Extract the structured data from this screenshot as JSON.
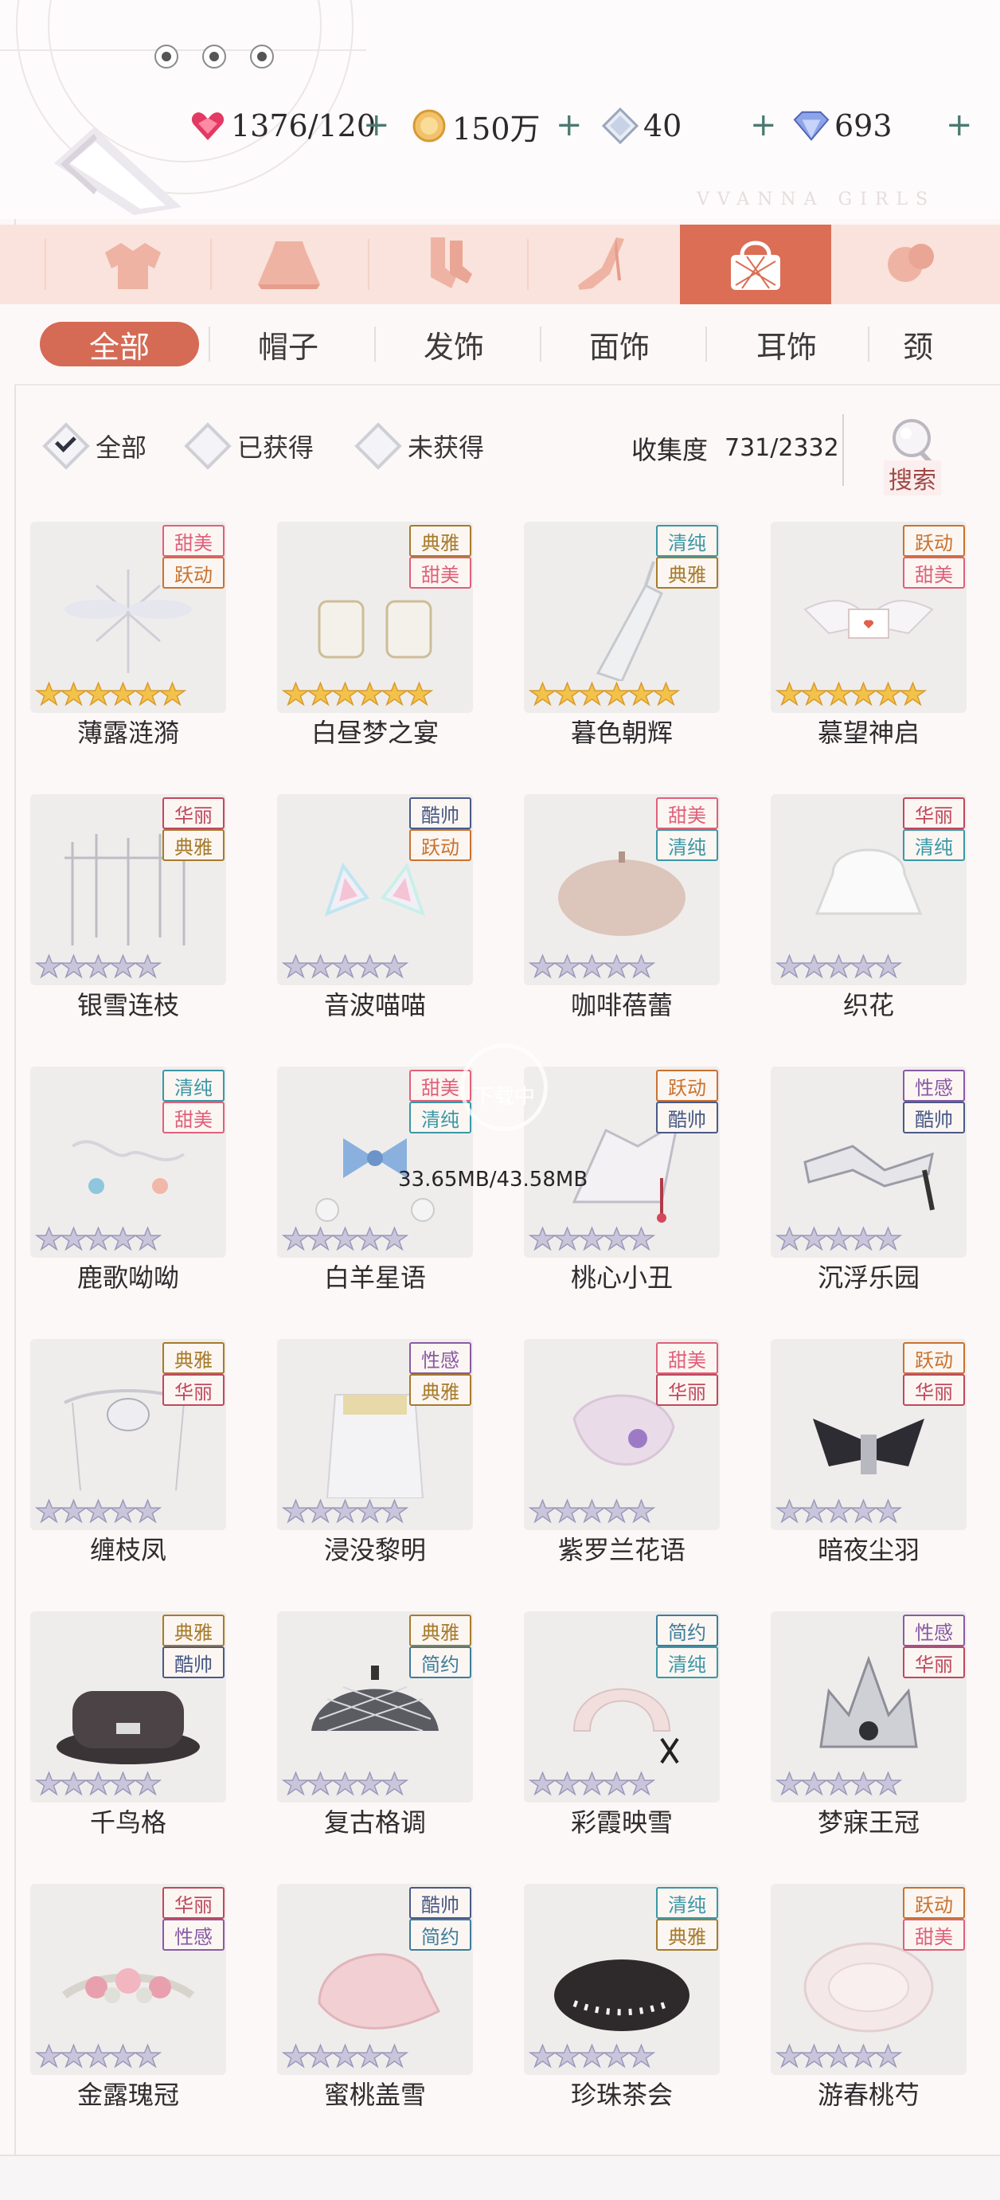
{
  "header": {
    "brand": "VVANNA GIRLS",
    "resources": [
      {
        "icon": "heart-gem-icon",
        "value": "1376/120"
      },
      {
        "icon": "gold-coin-icon",
        "value": "150万"
      },
      {
        "icon": "crystal-icon",
        "value": "40"
      },
      {
        "icon": "diamond-icon",
        "value": "693"
      }
    ],
    "plus_label": "+"
  },
  "categories": [
    {
      "icon": "hair-icon"
    },
    {
      "icon": "top-icon"
    },
    {
      "icon": "skirt-icon"
    },
    {
      "icon": "socks-icon"
    },
    {
      "icon": "shoes-icon"
    },
    {
      "icon": "handbag-icon",
      "active": true
    },
    {
      "icon": "makeup-icon"
    }
  ],
  "subcategories": [
    "全部",
    "帽子",
    "发饰",
    "面饰",
    "耳饰",
    "颈"
  ],
  "filters": [
    "全部",
    "已获得",
    "未获得"
  ],
  "collection": {
    "label": "收集度",
    "value": "731/2332"
  },
  "search_label": "搜索",
  "download": {
    "status": "下载中",
    "size": "33.65MB/43.58MB"
  },
  "tag_colors": {
    "甜美": "#e0607a",
    "跃动": "#c9722f",
    "典雅": "#a77a2a",
    "清纯": "#3b97a6",
    "华丽": "#c0485e",
    "酷帅": "#4a5a86",
    "性感": "#8a5aa6",
    "简约": "#3d7d9b"
  },
  "items": [
    {
      "name": "薄露涟漪",
      "tags": [
        "甜美",
        "跃动"
      ],
      "stars": 6,
      "gold": true
    },
    {
      "name": "白昼梦之宴",
      "tags": [
        "典雅",
        "甜美"
      ],
      "stars": 6,
      "gold": true
    },
    {
      "name": "暮色朝辉",
      "tags": [
        "清纯",
        "典雅"
      ],
      "stars": 6,
      "gold": true
    },
    {
      "name": "慕望神启",
      "tags": [
        "跃动",
        "甜美"
      ],
      "stars": 6,
      "gold": true
    },
    {
      "name": "银雪连枝",
      "tags": [
        "华丽",
        "典雅"
      ],
      "stars": 5,
      "gold": false
    },
    {
      "name": "音波喵喵",
      "tags": [
        "酷帅",
        "跃动"
      ],
      "stars": 5,
      "gold": false
    },
    {
      "name": "咖啡蓓蕾",
      "tags": [
        "甜美",
        "清纯"
      ],
      "stars": 5,
      "gold": false
    },
    {
      "name": "织花",
      "tags": [
        "华丽",
        "清纯"
      ],
      "stars": 5,
      "gold": false
    },
    {
      "name": "鹿歌呦呦",
      "tags": [
        "清纯",
        "甜美"
      ],
      "stars": 5,
      "gold": false
    },
    {
      "name": "白羊星语",
      "tags": [
        "甜美",
        "清纯"
      ],
      "stars": 5,
      "gold": false
    },
    {
      "name": "桃心小丑",
      "tags": [
        "跃动",
        "酷帅"
      ],
      "stars": 5,
      "gold": false
    },
    {
      "name": "沉浮乐园",
      "tags": [
        "性感",
        "酷帅"
      ],
      "stars": 5,
      "gold": false
    },
    {
      "name": "缠枝凤",
      "tags": [
        "典雅",
        "华丽"
      ],
      "stars": 5,
      "gold": false
    },
    {
      "name": "浸没黎明",
      "tags": [
        "性感",
        "典雅"
      ],
      "stars": 5,
      "gold": false
    },
    {
      "name": "紫罗兰花语",
      "tags": [
        "甜美",
        "华丽"
      ],
      "stars": 5,
      "gold": false
    },
    {
      "name": "暗夜尘羽",
      "tags": [
        "跃动",
        "华丽"
      ],
      "stars": 5,
      "gold": false
    },
    {
      "name": "千鸟格",
      "tags": [
        "典雅",
        "酷帅"
      ],
      "stars": 5,
      "gold": false
    },
    {
      "name": "复古格调",
      "tags": [
        "典雅",
        "简约"
      ],
      "stars": 5,
      "gold": false
    },
    {
      "name": "彩霞映雪",
      "tags": [
        "简约",
        "清纯"
      ],
      "stars": 5,
      "gold": false
    },
    {
      "name": "梦寐王冠",
      "tags": [
        "性感",
        "华丽"
      ],
      "stars": 5,
      "gold": false
    },
    {
      "name": "金露瑰冠",
      "tags": [
        "华丽",
        "性感"
      ],
      "stars": 5,
      "gold": false
    },
    {
      "name": "蜜桃盖雪",
      "tags": [
        "酷帅",
        "简约"
      ],
      "stars": 5,
      "gold": false
    },
    {
      "name": "珍珠茶会",
      "tags": [
        "清纯",
        "典雅"
      ],
      "stars": 5,
      "gold": false
    },
    {
      "name": "游春桃芍",
      "tags": [
        "跃动",
        "甜美"
      ],
      "stars": 5,
      "gold": false
    }
  ]
}
